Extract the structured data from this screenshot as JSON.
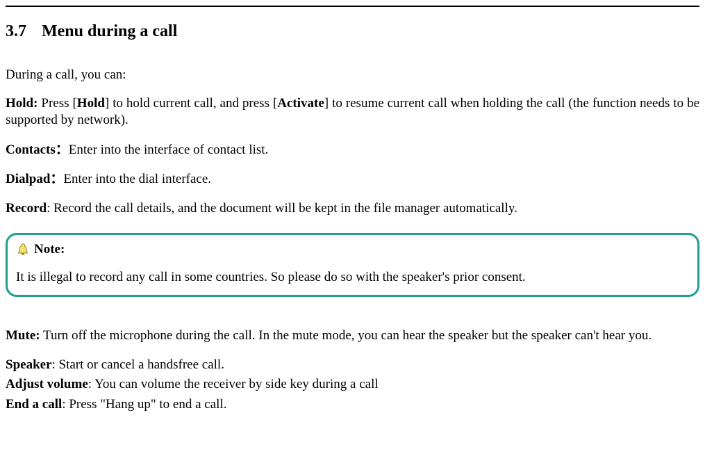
{
  "heading": {
    "number": "3.7",
    "title": "Menu during a call"
  },
  "intro": "During a call, you can:",
  "items": {
    "hold": {
      "label": "Hold:",
      "pre": " Press [",
      "key1": "Hold",
      "mid": "] to hold current call, and press [",
      "key2": "Activate",
      "post": "] to resume current call when holding the call (the function needs to be supported by network)."
    },
    "contacts": {
      "label": "Contacts：",
      "text": "Enter into the interface of contact list."
    },
    "dialpad": {
      "label": "Dialpad：",
      "text": "Enter into the dial interface."
    },
    "record": {
      "label": "Record",
      "text": ": Record the call details, and the document will be kept in the file manager automatically."
    },
    "mute": {
      "label": "Mute:",
      "text": " Turn off the microphone during the call. In the mute mode, you can hear the speaker but the speaker can't hear you."
    },
    "speaker": {
      "label": "Speaker",
      "text": ": Start or cancel a handsfree call."
    },
    "adjust": {
      "label": "Adjust volume",
      "text": ": You can volume the receiver by side key during a call"
    },
    "end": {
      "label": "End a call",
      "text": ": Press \"Hang up\" to end a call."
    }
  },
  "note": {
    "label": "Note:",
    "body": "It is illegal to record any call in some countries. So please do so with the speaker's prior consent."
  }
}
